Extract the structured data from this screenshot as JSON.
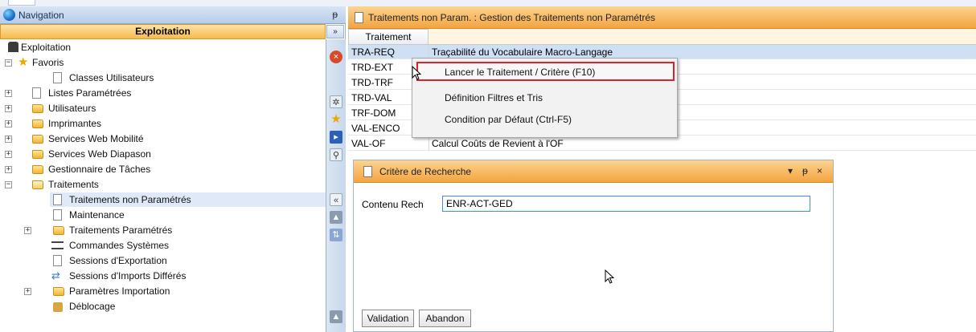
{
  "nav": {
    "title": "Navigation",
    "pin": "ᵽ",
    "section": "Exploitation",
    "collapse": "»",
    "tree": [
      {
        "label": "Exploitation"
      },
      {
        "label": "Favoris"
      },
      {
        "label": "Classes Utilisateurs"
      },
      {
        "label": "Listes Paramétrées"
      },
      {
        "label": "Utilisateurs"
      },
      {
        "label": "Imprimantes"
      },
      {
        "label": "Services Web Mobilité"
      },
      {
        "label": "Services Web Diapason"
      },
      {
        "label": "Gestionnaire de Tâches"
      },
      {
        "label": "Traitements"
      },
      {
        "label": "Traitements non Paramétrés"
      },
      {
        "label": "Maintenance"
      },
      {
        "label": "Traitements Paramétrés"
      },
      {
        "label": "Commandes Systèmes"
      },
      {
        "label": "Sessions d'Exportation"
      },
      {
        "label": "Sessions d'Imports Différés"
      },
      {
        "label": "Paramètres Importation"
      },
      {
        "label": "Déblocage"
      }
    ]
  },
  "main": {
    "title": "Traitements non Param. : Gestion des Traitements non Paramétrés",
    "column_header": "Traitement",
    "rows": [
      {
        "code": "TRA-REQ",
        "desc": "Traçabilité du Vocabulaire Macro-Langage"
      },
      {
        "code": "TRD-EXT",
        "desc": ""
      },
      {
        "code": "TRD-TRF",
        "desc": ""
      },
      {
        "code": "TRD-VAL",
        "desc": ""
      },
      {
        "code": "TRF-DOM",
        "desc": ""
      },
      {
        "code": "VAL-ENCO",
        "desc": ""
      },
      {
        "code": "VAL-OF",
        "desc": "Calcul Coûts de Revient à l'OF"
      }
    ]
  },
  "context_menu": {
    "items": [
      "Lancer le Traitement / Critère (F10)",
      "Définition Filtres et Tris",
      "Condition par Défaut (Ctrl-F5)"
    ]
  },
  "dialog": {
    "title": "Critère de Recherche",
    "controls": [
      "▾",
      "ᵽ",
      "×"
    ],
    "field_label": "Contenu Rech",
    "field_value": "ENR-ACT-GED",
    "validate": "Validation",
    "cancel": "Abandon"
  },
  "colors": {
    "accent_orange": "#f3a43f",
    "nav_blue": "#b9cde9",
    "highlight_red": "#d9222a"
  }
}
